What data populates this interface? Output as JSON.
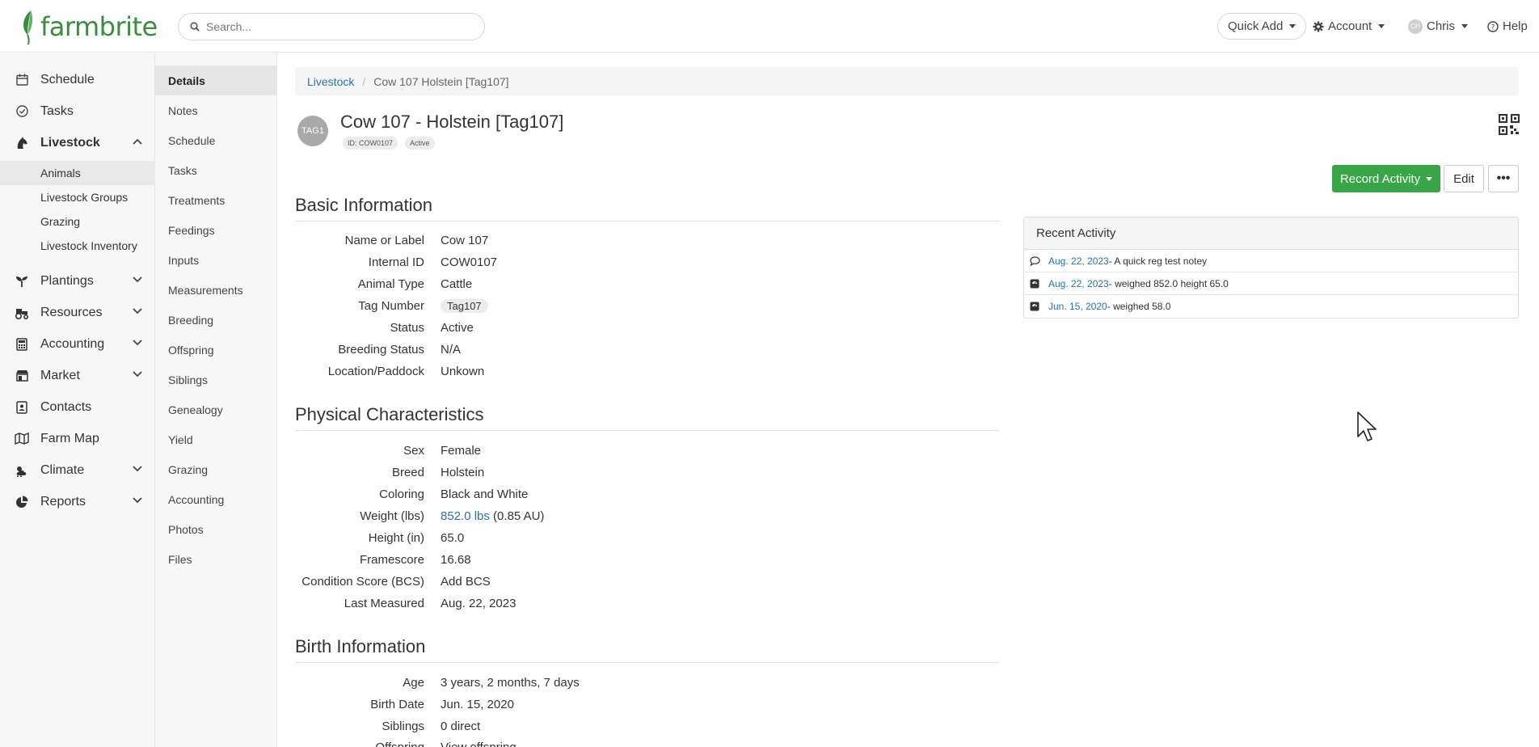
{
  "header": {
    "brand": "farmbrite",
    "search_placeholder": "Search...",
    "quick_add": "Quick Add",
    "account": "Account",
    "user_initials": "CH",
    "user": "Chris",
    "help": "Help"
  },
  "sidebar": {
    "items": [
      {
        "label": "Schedule"
      },
      {
        "label": "Tasks"
      },
      {
        "label": "Livestock"
      },
      {
        "label": "Plantings"
      },
      {
        "label": "Resources"
      },
      {
        "label": "Accounting"
      },
      {
        "label": "Market"
      },
      {
        "label": "Contacts"
      },
      {
        "label": "Farm Map"
      },
      {
        "label": "Climate"
      },
      {
        "label": "Reports"
      }
    ],
    "livestock_sub": [
      {
        "label": "Animals"
      },
      {
        "label": "Livestock Groups"
      },
      {
        "label": "Grazing"
      },
      {
        "label": "Livestock Inventory"
      }
    ]
  },
  "subnav": {
    "items": [
      "Details",
      "Notes",
      "Schedule",
      "Tasks",
      "Treatments",
      "Feedings",
      "Inputs",
      "Measurements",
      "Breeding",
      "Offspring",
      "Siblings",
      "Genealogy",
      "Yield",
      "Grazing",
      "Accounting",
      "Photos",
      "Files"
    ]
  },
  "breadcrumb": {
    "root": "Livestock",
    "current": "Cow 107 Holstein [Tag107]"
  },
  "animal": {
    "tag_circle": "TAG1",
    "title": "Cow 107 - Holstein [Tag107]",
    "id_pill": "ID: COW0107",
    "status_pill": "Active"
  },
  "actions": {
    "record_activity": "Record Activity",
    "edit": "Edit",
    "more": "•••"
  },
  "basic": {
    "heading": "Basic Information",
    "rows": [
      {
        "label": "Name or Label",
        "value": "Cow 107"
      },
      {
        "label": "Internal ID",
        "value": "COW0107"
      },
      {
        "label": "Animal Type",
        "value": "Cattle"
      },
      {
        "label": "Tag Number",
        "value": "Tag107"
      },
      {
        "label": "Status",
        "value": "Active"
      },
      {
        "label": "Breeding Status",
        "value": "N/A"
      },
      {
        "label": "Location/Paddock",
        "value": "Unkown"
      }
    ]
  },
  "physical": {
    "heading": "Physical Characteristics",
    "rows": [
      {
        "label": "Sex",
        "value": "Female"
      },
      {
        "label": "Breed",
        "value": "Holstein"
      },
      {
        "label": "Coloring",
        "value": "Black and White"
      },
      {
        "label": "Weight (lbs)",
        "value": "852.0 lbs",
        "extra": " (0.85 AU)"
      },
      {
        "label": "Height (in)",
        "value": "65.0"
      },
      {
        "label": "Framescore",
        "value": "16.68"
      },
      {
        "label": "Condition Score (BCS)",
        "value": "Add BCS"
      },
      {
        "label": "Last Measured",
        "value": "Aug. 22, 2023"
      }
    ]
  },
  "birth": {
    "heading": "Birth Information",
    "rows": [
      {
        "label": "Age",
        "value": "3 years, 2 months, 7 days"
      },
      {
        "label": "Birth Date",
        "value": "Jun. 15, 2020"
      },
      {
        "label": "Siblings",
        "value": "0 direct"
      },
      {
        "label": "Offspring",
        "value": "View offspring"
      }
    ]
  },
  "recent": {
    "heading": "Recent Activity",
    "items": [
      {
        "icon": "comment-icon",
        "date": "Aug. 22, 2023",
        "text": " - A quick reg test notey"
      },
      {
        "icon": "scale-icon",
        "date": "Aug. 22, 2023",
        "text": " - weighed 852.0 height 65.0"
      },
      {
        "icon": "scale-icon",
        "date": "Jun. 15, 2020",
        "text": " - weighed 58.0"
      }
    ]
  },
  "colors": {
    "brand_green": "#3a8d3f",
    "button_green": "#38a646",
    "link_blue": "#2a6fb0"
  }
}
